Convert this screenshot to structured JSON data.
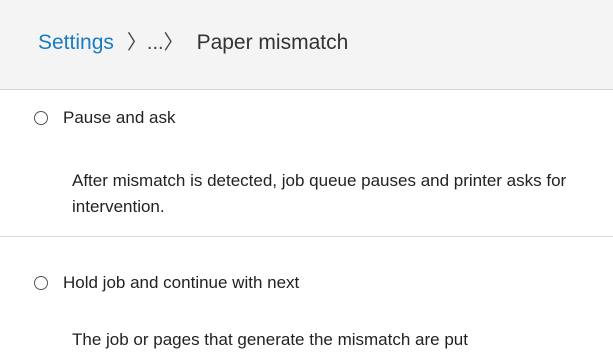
{
  "breadcrumb": {
    "root": "Settings",
    "separator": "〉...〉",
    "current": "Paper mismatch"
  },
  "options": [
    {
      "label": "Pause and ask",
      "description": "After mismatch is detected, job queue pauses and printer asks for intervention.",
      "selected": false
    },
    {
      "label": "Hold job and continue with next",
      "description": "The job or pages that generate the mismatch are put",
      "selected": false
    }
  ]
}
